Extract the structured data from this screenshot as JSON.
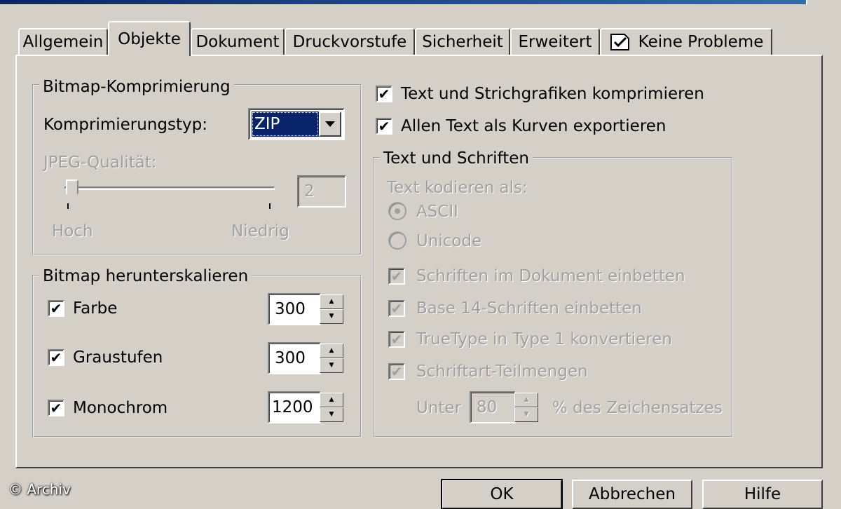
{
  "tabs": [
    {
      "label": "Allgemein"
    },
    {
      "label": "Objekte"
    },
    {
      "label": "Dokument"
    },
    {
      "label": "Druckvorstufe"
    },
    {
      "label": "Sicherheit"
    },
    {
      "label": "Erweitert"
    },
    {
      "label": "Keine Probleme"
    }
  ],
  "compression": {
    "legend": "Bitmap-Komprimierung",
    "type_label": "Komprimierungstyp:",
    "type_value": "ZIP",
    "jpeg_label": "JPEG-Qualität:",
    "jpeg_value": "2",
    "jpeg_level": 0.02,
    "slider_min_label": "Hoch",
    "slider_max_label": "Niedrig"
  },
  "downsample": {
    "legend": "Bitmap herunterskalieren",
    "rows": [
      {
        "label": "Farbe",
        "value": "300",
        "checked": true
      },
      {
        "label": "Graustufen",
        "value": "300",
        "checked": true
      },
      {
        "label": "Monochrom",
        "value": "1200",
        "checked": true
      }
    ]
  },
  "right": {
    "compress_text": "Text und Strichgrafiken komprimieren",
    "export_curves": "Allen Text als Kurven exportieren"
  },
  "fonts": {
    "legend": "Text und Schriften",
    "encode_label": "Text kodieren als:",
    "radio_ascii": "ASCII",
    "radio_unicode": "Unicode",
    "embed_fonts": "Schriften im Dokument einbetten",
    "base14": "Base 14-Schriften einbetten",
    "truetype": "TrueType in Type 1 konvertieren",
    "subset": "Schriftart-Teilmengen",
    "under_label": "Unter",
    "under_value": "80",
    "percent_label": "% des Zeichensatzes"
  },
  "buttons": {
    "ok": "OK",
    "cancel": "Abbrechen",
    "help": "Hilfe"
  },
  "watermark": "© Archiv",
  "colors": {
    "face": "#d4d0c8",
    "selection": "#0a246a",
    "disabled": "#a0a0a0"
  }
}
